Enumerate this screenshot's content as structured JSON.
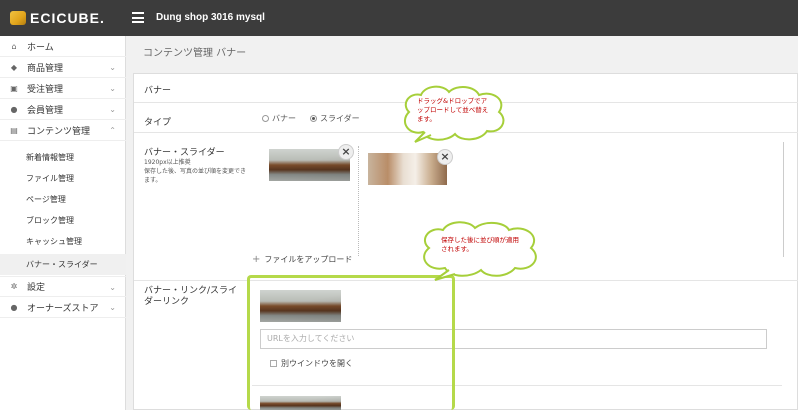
{
  "header": {
    "logo_text": "ECICUBE.",
    "shop_name": "Dung shop 3016 mysql"
  },
  "sidebar": {
    "items": [
      {
        "label": "ホーム",
        "icon": "home-icon",
        "glyph": "⌂"
      },
      {
        "label": "商品管理",
        "icon": "tag-icon",
        "glyph": "◆",
        "chevron": "⌄"
      },
      {
        "label": "受注管理",
        "icon": "cart-icon",
        "glyph": "▣",
        "chevron": "⌄"
      },
      {
        "label": "会員管理",
        "icon": "users-icon",
        "glyph": "●",
        "chevron": "⌄"
      },
      {
        "label": "コンテンツ管理",
        "icon": "document-icon",
        "glyph": "▤",
        "chevron": "⌃"
      }
    ],
    "sub_items": [
      {
        "label": "新着情報管理"
      },
      {
        "label": "ファイル管理"
      },
      {
        "label": "ページ管理"
      },
      {
        "label": "ブロック管理"
      },
      {
        "label": "キャッシュ管理"
      },
      {
        "label": "バナー・スライダー"
      }
    ],
    "bottom_items": [
      {
        "label": "設定",
        "icon": "gear-icon",
        "glyph": "✲",
        "chevron": "⌄"
      },
      {
        "label": "オーナーズストア",
        "icon": "info-icon",
        "glyph": "●",
        "chevron": "⌄"
      }
    ]
  },
  "page": {
    "title": "コンテンツ管理 バナー"
  },
  "card": {
    "title": "バナー",
    "type_label": "タイプ",
    "type_options": [
      "バナー",
      "スライダー"
    ],
    "type_selected": "スライダー",
    "images_label": "バナー・スライダー",
    "images_note": "1920px以上推奨\n保存した後、写真の並び順を変更できます。",
    "upload_label": "ファイルをアップロード",
    "link_label": "バナー・リンク/スライダーリンク",
    "url_placeholder": "URLを入力してください",
    "new_window_label": "別ウインドウを開く"
  },
  "annotations": {
    "drag_note": "ドラッグ&ドロップでアップロードして並べ替えます。",
    "order_note": "保存した後に並び順が適用されます。"
  },
  "colors": {
    "topbar": "#3c3c3c",
    "highlight": "#b5d94a",
    "annotation_text": "#c00000"
  }
}
